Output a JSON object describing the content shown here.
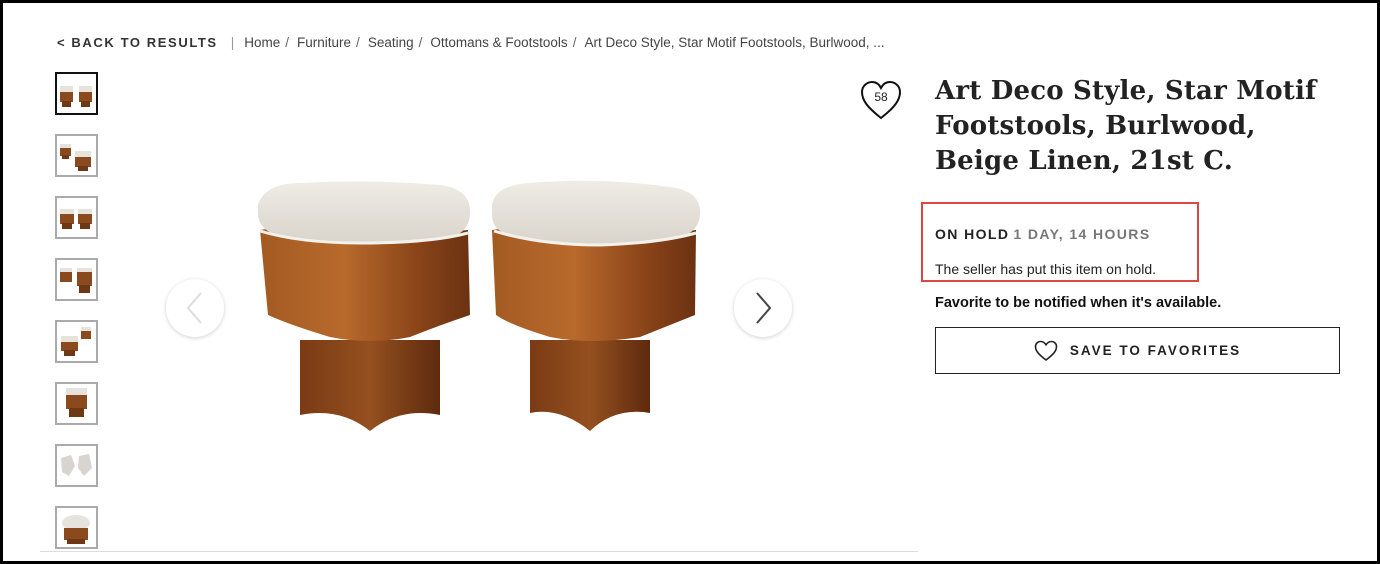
{
  "breadcrumb": {
    "back_label": "< BACK TO RESULTS",
    "separator": "|",
    "items": [
      "Home",
      "Furniture",
      "Seating",
      "Ottomans & Footstools",
      "Art Deco Style, Star Motif Footstools, Burlwood, ..."
    ]
  },
  "gallery": {
    "thumbnail_count": 8,
    "active_index": 0,
    "prev_icon": "chevron-left-icon",
    "next_icon": "chevron-right-icon"
  },
  "favorites": {
    "count": "58",
    "icon": "heart-icon"
  },
  "product": {
    "title": "Art Deco Style, Star Motif Footstools, Burlwood, Beige Linen, 21st C.",
    "hold_label": "ON HOLD",
    "hold_time": "1 DAY, 14 HOURS",
    "hold_message": "The seller has put this item on hold.",
    "notify_text": "Favorite to be notified when it's available.",
    "save_button_label": "SAVE TO FAVORITES"
  },
  "colors": {
    "highlight_border": "#e04545",
    "wood": "#8a4a1e",
    "cushion": "#e6e3dc"
  }
}
